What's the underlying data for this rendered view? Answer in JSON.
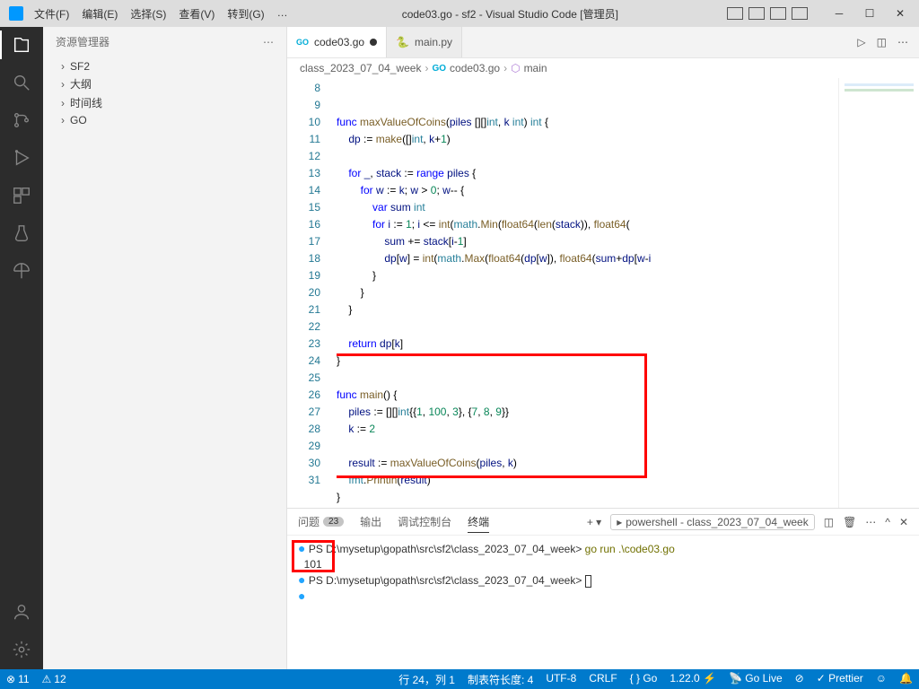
{
  "titlebar": {
    "menus": [
      "文件(F)",
      "编辑(E)",
      "选择(S)",
      "查看(V)",
      "转到(G)",
      "…"
    ],
    "title": "code03.go - sf2 - Visual Studio Code [管理员]"
  },
  "activitybar": {
    "items": [
      "files",
      "search",
      "scm",
      "debug",
      "extensions",
      "test",
      "remote"
    ]
  },
  "sidebar": {
    "title": "资源管理器",
    "items": [
      {
        "label": "SF2"
      },
      {
        "label": "大纲"
      },
      {
        "label": "时间线"
      },
      {
        "label": "GO"
      }
    ]
  },
  "tabs": [
    {
      "label": "code03.go",
      "lang": "go",
      "active": true,
      "dirty": true
    },
    {
      "label": "main.py",
      "lang": "py",
      "active": false,
      "dirty": false
    }
  ],
  "breadcrumb": {
    "parts": [
      "class_2023_07_04_week",
      "code03.go",
      "main"
    ]
  },
  "gutter_start": 8,
  "code_lines": [
    {
      "n": 8,
      "html": "<span class='kw'>func</span> <span class='fn'>maxValueOfCoins</span>(<span class='id'>piles</span> [][]<span class='typ'>int</span>, <span class='id'>k</span> <span class='typ'>int</span>) <span class='typ'>int</span> {"
    },
    {
      "n": 9,
      "html": "    <span class='id'>dp</span> := <span class='fn'>make</span>([]<span class='typ'>int</span>, <span class='id'>k</span>+<span class='num'>1</span>)"
    },
    {
      "n": 10,
      "html": ""
    },
    {
      "n": 11,
      "html": "    <span class='kw'>for</span> <span class='id'>_</span>, <span class='id'>stack</span> := <span class='kw'>range</span> <span class='id'>piles</span> {"
    },
    {
      "n": 12,
      "html": "        <span class='kw'>for</span> <span class='id'>w</span> := <span class='id'>k</span>; <span class='id'>w</span> &gt; <span class='num'>0</span>; <span class='id'>w</span>-- {"
    },
    {
      "n": 13,
      "html": "            <span class='kw'>var</span> <span class='id'>sum</span> <span class='typ'>int</span>"
    },
    {
      "n": 14,
      "html": "            <span class='kw'>for</span> <span class='id'>i</span> := <span class='num'>1</span>; <span class='id'>i</span> &lt;= <span class='fn'>int</span>(<span class='pkg'>math</span>.<span class='fn'>Min</span>(<span class='fn'>float64</span>(<span class='fn'>len</span>(<span class='id'>stack</span>)), <span class='fn'>float64</span>("
    },
    {
      "n": 15,
      "html": "                <span class='id'>sum</span> += <span class='id'>stack</span>[<span class='id'>i</span>-<span class='num'>1</span>]"
    },
    {
      "n": 16,
      "html": "                <span class='id'>dp</span>[<span class='id'>w</span>] = <span class='fn'>int</span>(<span class='pkg'>math</span>.<span class='fn'>Max</span>(<span class='fn'>float64</span>(<span class='id'>dp</span>[<span class='id'>w</span>]), <span class='fn'>float64</span>(<span class='id'>sum</span>+<span class='id'>dp</span>[<span class='id'>w</span>-<span class='id'>i</span>"
    },
    {
      "n": 17,
      "html": "            }"
    },
    {
      "n": 18,
      "html": "        }"
    },
    {
      "n": 19,
      "html": "    }"
    },
    {
      "n": 20,
      "html": ""
    },
    {
      "n": 21,
      "html": "    <span class='kw'>return</span> <span class='id'>dp</span>[<span class='id'>k</span>]"
    },
    {
      "n": 22,
      "html": "}"
    },
    {
      "n": 23,
      "html": ""
    },
    {
      "n": 24,
      "html": "<span class='kw'>func</span> <span class='fn'>main</span>() {"
    },
    {
      "n": 25,
      "html": "    <span class='id'>piles</span> := [][]<span class='typ'>int</span>{{<span class='num'>1</span>, <span class='num'>100</span>, <span class='num'>3</span>}, {<span class='num'>7</span>, <span class='num'>8</span>, <span class='num'>9</span>}}"
    },
    {
      "n": 26,
      "html": "    <span class='id'>k</span> := <span class='num'>2</span>"
    },
    {
      "n": 27,
      "html": ""
    },
    {
      "n": 28,
      "html": "    <span class='id'>result</span> := <span class='fn'>maxValueOfCoins</span>(<span class='id'>piles</span>, <span class='id'>k</span>)"
    },
    {
      "n": 29,
      "html": "    <span class='pkg'>fmt</span>.<span class='fn'>Println</span>(<span class='id'>result</span>)"
    },
    {
      "n": 30,
      "html": "}"
    },
    {
      "n": 31,
      "html": ""
    }
  ],
  "panel": {
    "tabs": [
      {
        "label": "问题",
        "badge": "23"
      },
      {
        "label": "输出"
      },
      {
        "label": "调试控制台"
      },
      {
        "label": "终端",
        "active": true
      }
    ],
    "shell_label": "powershell - class_2023_07_04_week",
    "lines": [
      {
        "prompt": true,
        "path": "PS D:\\mysetup\\gopath\\src\\sf2\\class_2023_07_04_week>",
        "cmd": " go run .\\code03.go"
      },
      {
        "out": "101"
      },
      {
        "prompt": true,
        "path": "PS D:\\mysetup\\gopath\\src\\sf2\\class_2023_07_04_week>",
        "cursor": true
      }
    ]
  },
  "statusbar": {
    "left": [
      {
        "icon": "⊗",
        "text": "11"
      },
      {
        "icon": "⚠",
        "text": "12"
      }
    ],
    "right": [
      {
        "text": "行 24，列 1"
      },
      {
        "text": "制表符长度: 4"
      },
      {
        "text": "UTF-8"
      },
      {
        "text": "CRLF"
      },
      {
        "text": "{ } Go"
      },
      {
        "text": "1.22.0 ⚡"
      },
      {
        "text": "📡 Go Live"
      },
      {
        "icon": "⊘"
      },
      {
        "text": "✓ Prettier"
      },
      {
        "icon": "☺"
      },
      {
        "icon": "🔔"
      }
    ]
  }
}
